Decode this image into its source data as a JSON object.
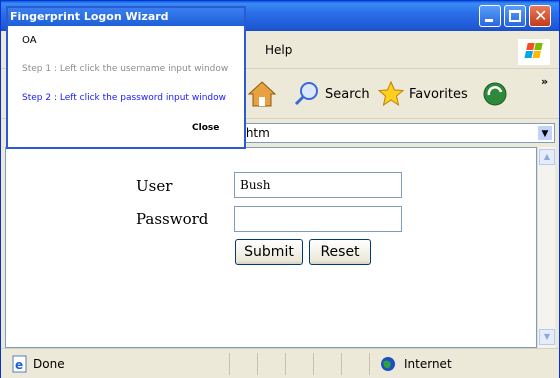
{
  "wizard": {
    "title": "Fingerprint Logon Wizard",
    "app_name": "OA",
    "step1": "Step 1 : Left click the username input window",
    "step2": "Step 2 : Left click the password input window",
    "close_label": "Close"
  },
  "browser": {
    "menu_help": "Help",
    "toolbar": {
      "search_label": "Search",
      "favorites_label": "Favorites"
    },
    "address_value": ".htm",
    "status_text": "Done",
    "zone_text": "Internet"
  },
  "page_form": {
    "user_label": "User",
    "user_value": "Bush",
    "password_label": "Password",
    "password_value": "",
    "submit_label": "Submit",
    "reset_label": "Reset"
  },
  "colors": {
    "titlebar_blue": "#2a6fe8",
    "wizard_step2": "#1a1aff",
    "wizard_step1": "#8c8c8c"
  }
}
